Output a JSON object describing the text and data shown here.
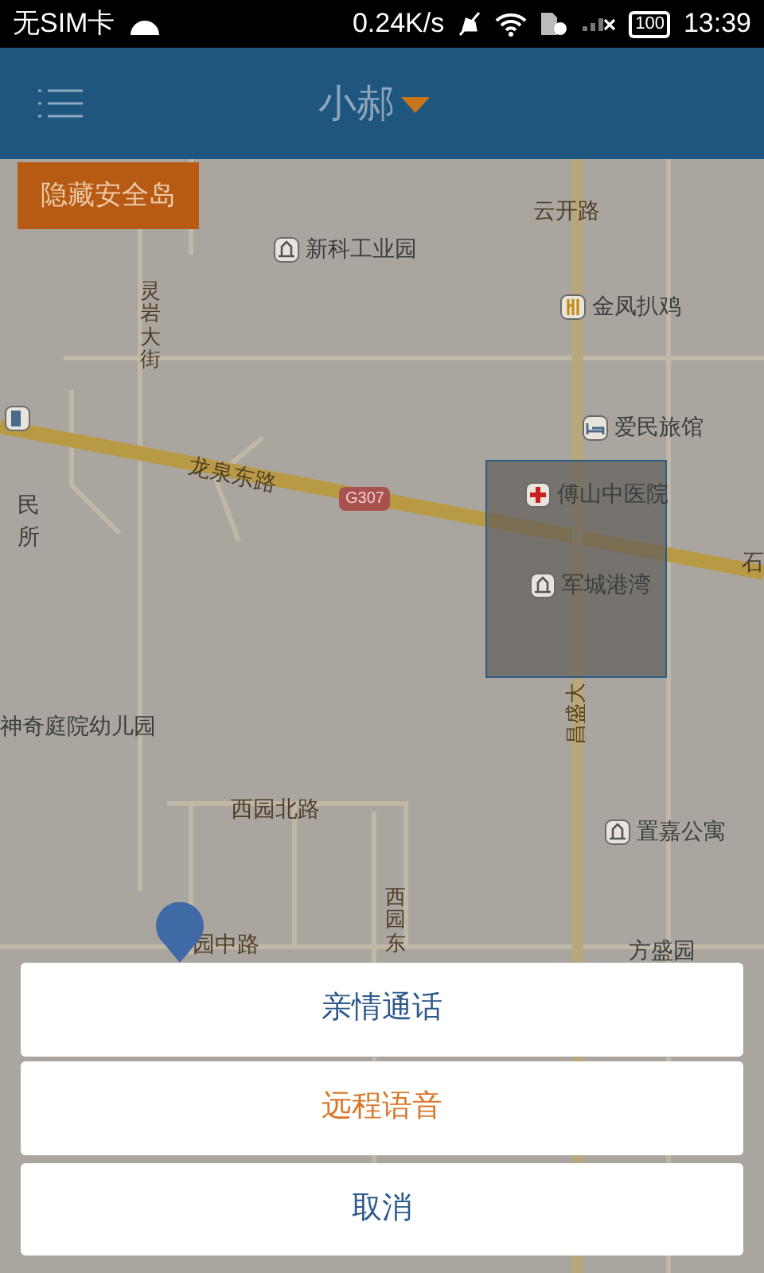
{
  "status_bar": {
    "carrier": "无SIM卡",
    "speed": "0.24K/s",
    "battery": "100",
    "time": "13:39"
  },
  "header": {
    "title": "小郝"
  },
  "map": {
    "hide_button": "隐藏安全岛",
    "labels": [
      {
        "kind": "road",
        "text": "云开路"
      },
      {
        "kind": "poi",
        "text": "新科工业园"
      },
      {
        "kind": "vroad",
        "text": "灵岩大街"
      },
      {
        "kind": "poi",
        "text": "金凤扒鸡"
      },
      {
        "kind": "poi",
        "text": "爱民旅馆"
      },
      {
        "kind": "road",
        "text": "龙泉东路"
      },
      {
        "kind": "place",
        "text": "民"
      },
      {
        "kind": "place",
        "text": "所"
      },
      {
        "kind": "shield",
        "text": "G307"
      },
      {
        "kind": "poi",
        "text": "傅山中医院"
      },
      {
        "kind": "poi",
        "text": "军城港湾"
      },
      {
        "kind": "road",
        "text": "石"
      },
      {
        "kind": "place",
        "text": "神奇庭院幼儿园"
      },
      {
        "kind": "rroad",
        "text": "昌盛大"
      },
      {
        "kind": "road",
        "text": "西园北路"
      },
      {
        "kind": "vroad",
        "text": "西园东"
      },
      {
        "kind": "poi",
        "text": "置嘉公寓"
      },
      {
        "kind": "road",
        "text": "园中路"
      },
      {
        "kind": "place",
        "text": "方盛园"
      }
    ]
  },
  "action_sheet": {
    "actions": [
      {
        "label": "亲情通话",
        "selected": false
      },
      {
        "label": "远程语音",
        "selected": true
      }
    ],
    "cancel": "取消"
  }
}
